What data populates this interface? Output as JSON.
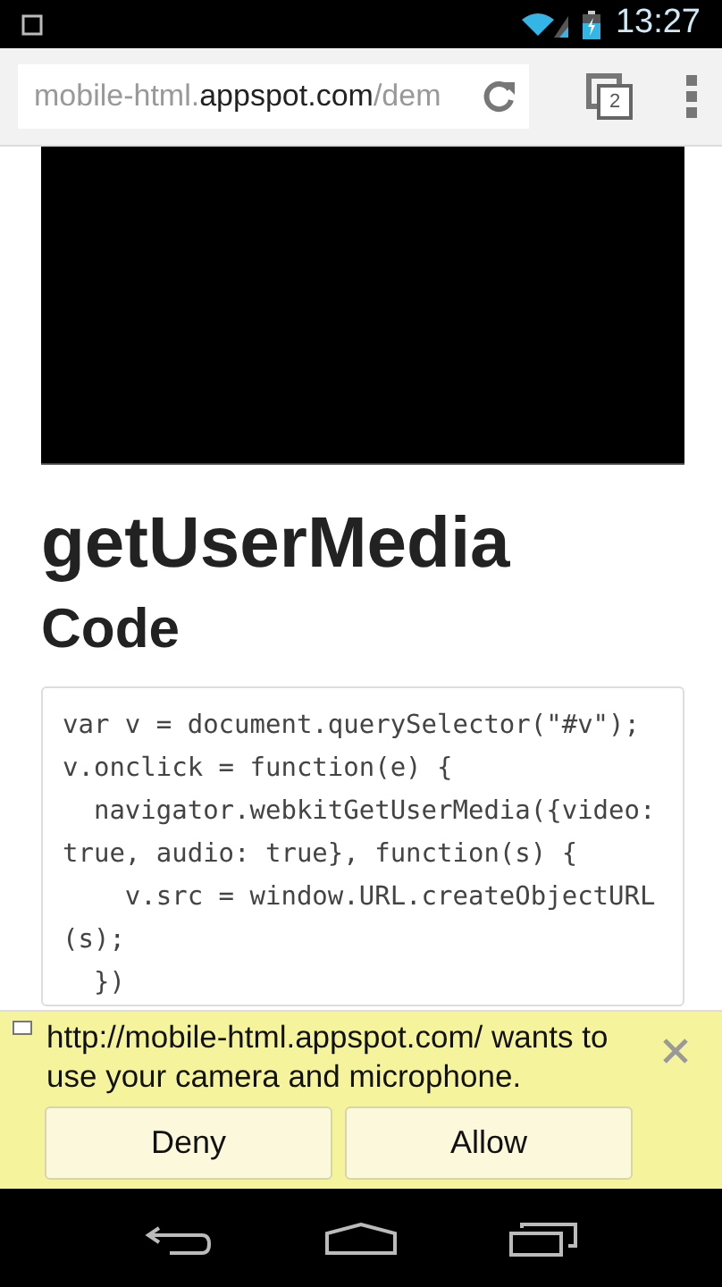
{
  "status_bar": {
    "time": "13:27"
  },
  "address_bar": {
    "url_prefix": "mobile-html.",
    "url_domain": "appspot.com",
    "url_suffix": "/dem",
    "tab_count": "2"
  },
  "page": {
    "title": "getUserMedia",
    "section_heading": "Code",
    "code_lines": [
      "var v = document.querySelector(\"#v\");",
      "v.onclick = function(e) {",
      "  navigator.webkitGetUserMedia({video:",
      "true, audio: true}, function(s) {",
      "    v.src = window.URL.createObjectURL",
      "(s);",
      "  })"
    ]
  },
  "infobar": {
    "message": "http://mobile-html.appspot.com/ wants to use your camera and microphone.",
    "buttons": [
      "Deny",
      "Allow"
    ]
  }
}
